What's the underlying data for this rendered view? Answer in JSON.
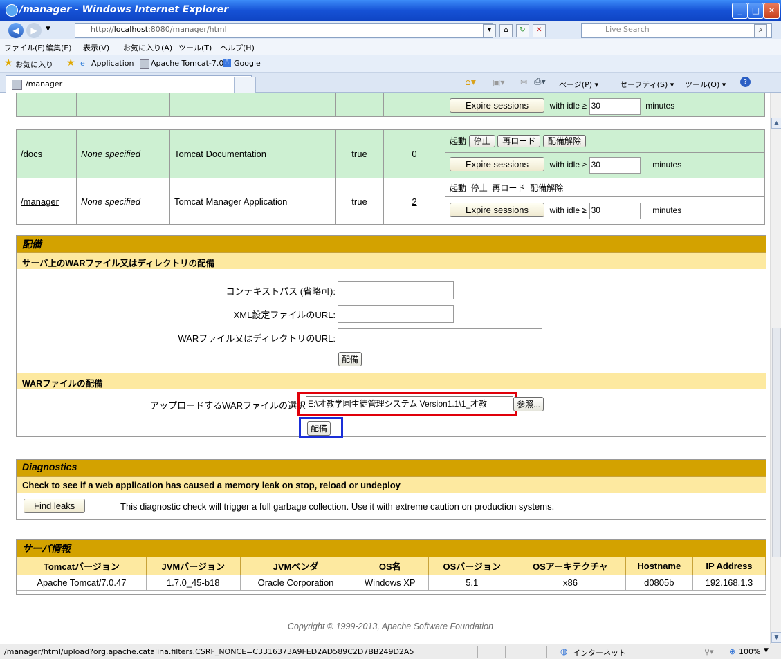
{
  "window": {
    "title": "/manager - Windows Internet Explorer",
    "min": "_",
    "max": "□",
    "close": "✕"
  },
  "address": {
    "url_prefix": "http://",
    "url_host": "localhost",
    "url_rest": ":8080/manager/html",
    "search_placeholder": "Live Search"
  },
  "menu": [
    "ファイル(F)",
    "編集(E)",
    "表示(V)",
    "お気に入り(A)",
    "ツール(T)",
    "ヘルプ(H)"
  ],
  "favorites": {
    "label": "お気に入り",
    "items": [
      "Application",
      "Apache Tomcat-7.0",
      "Google"
    ]
  },
  "tab": {
    "title": "/manager"
  },
  "commandbar": {
    "page": "ページ(P) ▾",
    "safety": "セーフティ(S) ▾",
    "tools": "ツール(O) ▾"
  },
  "apps": {
    "partial_row": {
      "expire": "Expire sessions",
      "idle": "with idle ≥",
      "idle_val": "30",
      "minutes": "minutes"
    },
    "rows": [
      {
        "path": "/docs",
        "version": "None specified",
        "name": "Tomcat Documentation",
        "running": "true",
        "sessions": "0",
        "cmd_start": "起動",
        "cmd_stop": "停止",
        "cmd_reload": "再ロード",
        "cmd_undeploy": "配備解除",
        "expire": "Expire sessions",
        "idle": "with idle ≥",
        "idle_val": "30",
        "minutes": "minutes"
      },
      {
        "path": "/manager",
        "version": "None specified",
        "name": "Tomcat Manager Application",
        "running": "true",
        "sessions": "2",
        "cmd_start": "起動",
        "cmd_stop": "停止",
        "cmd_reload": "再ロード",
        "cmd_undeploy": "配備解除",
        "expire": "Expire sessions",
        "idle": "with idle ≥",
        "idle_val": "30",
        "minutes": "minutes"
      }
    ]
  },
  "deploy": {
    "title": "配備",
    "server_sub": "サーバ上のWARファイル又はディレクトリの配備",
    "context_label": "コンテキストパス (省略可):",
    "xml_label": "XML設定ファイルのURL:",
    "war_label": "WARファイル又はディレクトリのURL:",
    "deploy_btn": "配備",
    "upload_sub": "WARファイルの配備",
    "upload_label": "アップロードするWARファイルの選択",
    "upload_value": "E:\\才教学園生徒管理システム Version1.1\\1_才教",
    "browse_btn": "参照...",
    "upload_btn": "配備"
  },
  "diagnostics": {
    "title": "Diagnostics",
    "sub": "Check to see if a web application has caused a memory leak on stop, reload or undeploy",
    "button": "Find leaks",
    "desc": "This diagnostic check will trigger a full garbage collection. Use it with extreme caution on production systems."
  },
  "serverinfo": {
    "title": "サーバ情報",
    "headers": [
      "Tomcatバージョン",
      "JVMバージョン",
      "JVMベンダ",
      "OS名",
      "OSバージョン",
      "OSアーキテクチャ",
      "Hostname",
      "IP Address"
    ],
    "values": [
      "Apache Tomcat/7.0.47",
      "1.7.0_45-b18",
      "Oracle Corporation",
      "Windows XP",
      "5.1",
      "x86",
      "d0805b",
      "192.168.1.3"
    ]
  },
  "copyright": "Copyright © 1999-2013, Apache Software Foundation",
  "status": {
    "url": "/manager/html/upload?org.apache.catalina.filters.CSRF_NONCE=C3316373A9FED2AD589C2D7BB249D2A5",
    "zone": "インターネット",
    "zoom": "100%"
  },
  "highlights": {
    "red": "#e0000a",
    "blue": "#1a2fd8"
  }
}
